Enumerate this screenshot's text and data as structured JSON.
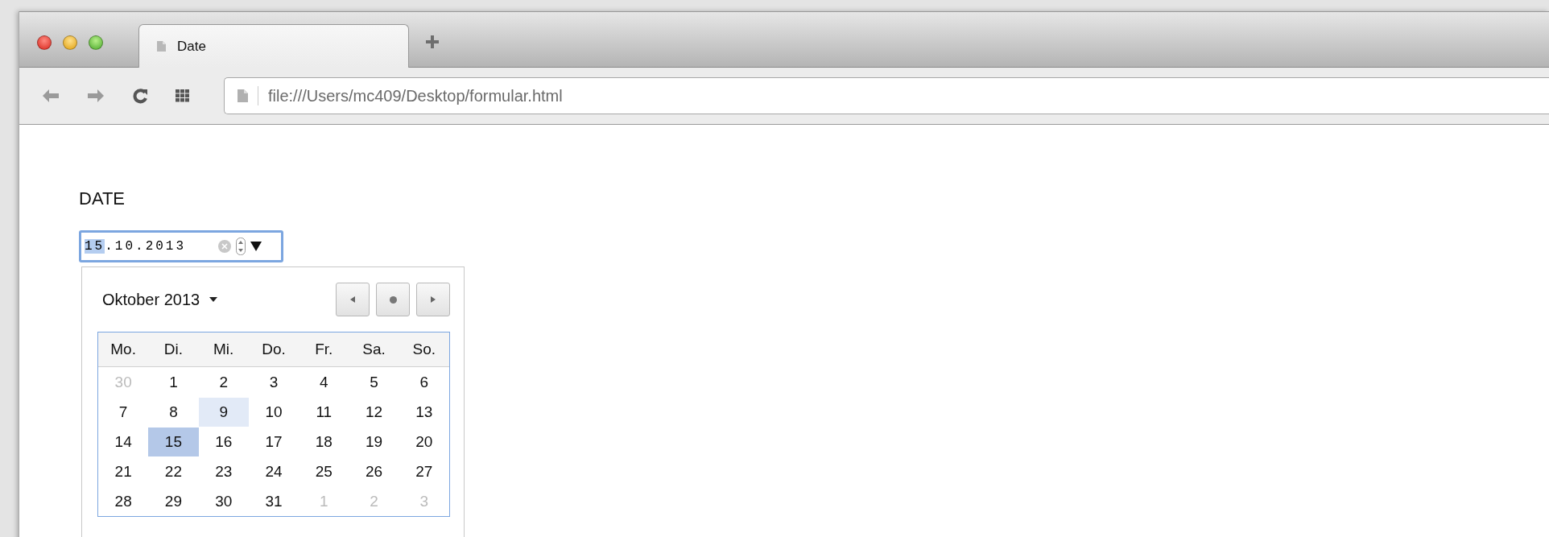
{
  "browser": {
    "tabs": [
      {
        "title": "Date",
        "selected": true
      }
    ],
    "address": "file:///Users/mc409/Desktop/formular.html"
  },
  "page": {
    "label": "DATE",
    "date_input": {
      "segments": [
        {
          "text": "15",
          "selected": true
        },
        {
          "text": ".",
          "selected": false
        },
        {
          "text": "10",
          "selected": false
        },
        {
          "text": ".",
          "selected": false
        },
        {
          "text": "2013",
          "selected": false
        }
      ]
    },
    "calendar": {
      "month_label": "Oktober 2013",
      "weekdays": [
        "Mo.",
        "Di.",
        "Mi.",
        "Do.",
        "Fr.",
        "Sa.",
        "So."
      ],
      "weeks": [
        [
          {
            "day": "30",
            "other_month": true,
            "selected": false,
            "hovered": false
          },
          {
            "day": "1",
            "other_month": false,
            "selected": false,
            "hovered": false
          },
          {
            "day": "2",
            "other_month": false,
            "selected": false,
            "hovered": false
          },
          {
            "day": "3",
            "other_month": false,
            "selected": false,
            "hovered": false
          },
          {
            "day": "4",
            "other_month": false,
            "selected": false,
            "hovered": false
          },
          {
            "day": "5",
            "other_month": false,
            "selected": false,
            "hovered": false
          },
          {
            "day": "6",
            "other_month": false,
            "selected": false,
            "hovered": false
          }
        ],
        [
          {
            "day": "7",
            "other_month": false,
            "selected": false,
            "hovered": false
          },
          {
            "day": "8",
            "other_month": false,
            "selected": false,
            "hovered": false
          },
          {
            "day": "9",
            "other_month": false,
            "selected": false,
            "hovered": true
          },
          {
            "day": "10",
            "other_month": false,
            "selected": false,
            "hovered": false
          },
          {
            "day": "11",
            "other_month": false,
            "selected": false,
            "hovered": false
          },
          {
            "day": "12",
            "other_month": false,
            "selected": false,
            "hovered": false
          },
          {
            "day": "13",
            "other_month": false,
            "selected": false,
            "hovered": false
          }
        ],
        [
          {
            "day": "14",
            "other_month": false,
            "selected": false,
            "hovered": false
          },
          {
            "day": "15",
            "other_month": false,
            "selected": true,
            "hovered": false
          },
          {
            "day": "16",
            "other_month": false,
            "selected": false,
            "hovered": false
          },
          {
            "day": "17",
            "other_month": false,
            "selected": false,
            "hovered": false
          },
          {
            "day": "18",
            "other_month": false,
            "selected": false,
            "hovered": false
          },
          {
            "day": "19",
            "other_month": false,
            "selected": false,
            "hovered": false
          },
          {
            "day": "20",
            "other_month": false,
            "selected": false,
            "hovered": false
          }
        ],
        [
          {
            "day": "21",
            "other_month": false,
            "selected": false,
            "hovered": false
          },
          {
            "day": "22",
            "other_month": false,
            "selected": false,
            "hovered": false
          },
          {
            "day": "23",
            "other_month": false,
            "selected": false,
            "hovered": false
          },
          {
            "day": "24",
            "other_month": false,
            "selected": false,
            "hovered": false
          },
          {
            "day": "25",
            "other_month": false,
            "selected": false,
            "hovered": false
          },
          {
            "day": "26",
            "other_month": false,
            "selected": false,
            "hovered": false
          },
          {
            "day": "27",
            "other_month": false,
            "selected": false,
            "hovered": false
          }
        ],
        [
          {
            "day": "28",
            "other_month": false,
            "selected": false,
            "hovered": false
          },
          {
            "day": "29",
            "other_month": false,
            "selected": false,
            "hovered": false
          },
          {
            "day": "30",
            "other_month": false,
            "selected": false,
            "hovered": false
          },
          {
            "day": "31",
            "other_month": false,
            "selected": false,
            "hovered": false
          },
          {
            "day": "1",
            "other_month": true,
            "selected": false,
            "hovered": false
          },
          {
            "day": "2",
            "other_month": true,
            "selected": false,
            "hovered": false
          },
          {
            "day": "3",
            "other_month": true,
            "selected": false,
            "hovered": false
          }
        ]
      ]
    }
  }
}
